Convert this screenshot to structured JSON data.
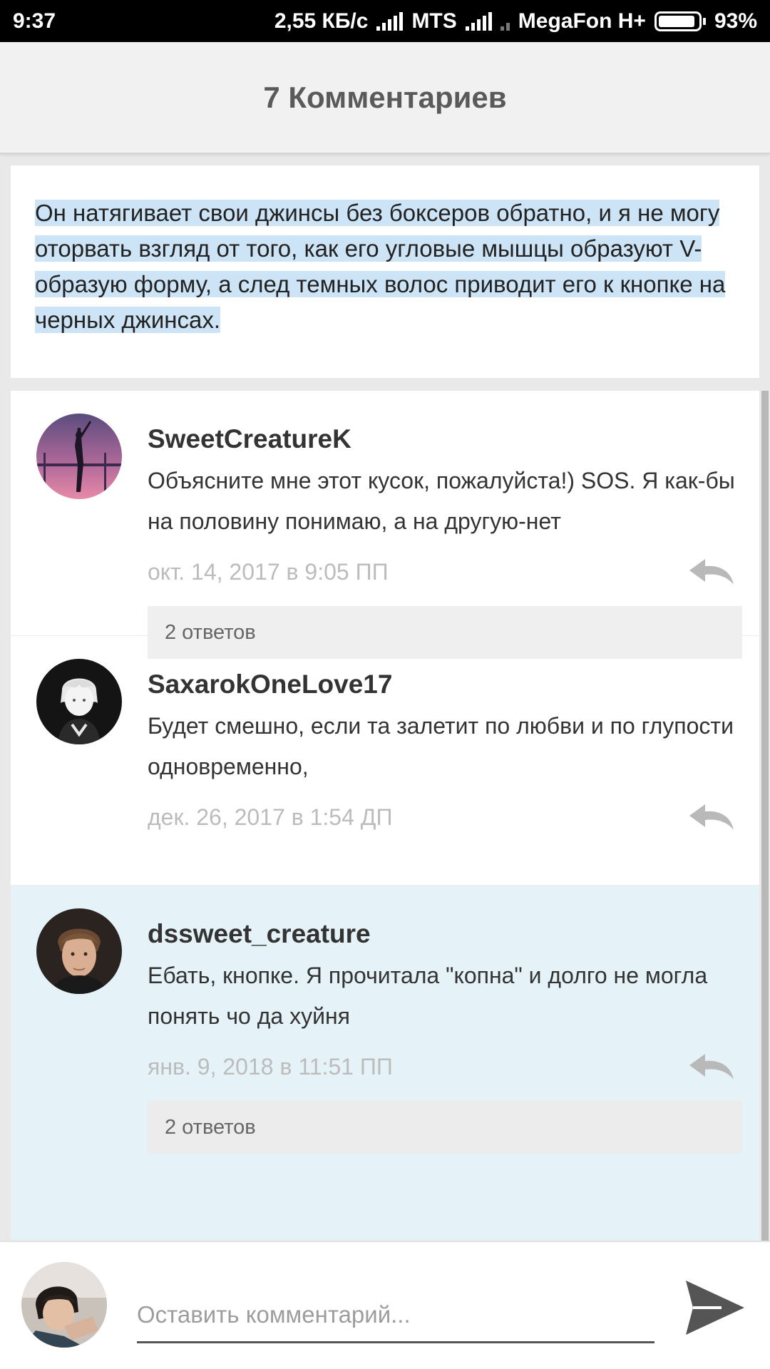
{
  "status_bar": {
    "time": "9:37",
    "speed": "2,55 КБ/с",
    "carrier1": "MTS",
    "carrier2": "MegaFon H+",
    "battery": "93%",
    "battery_level": 0.93
  },
  "header": {
    "title": "7 Комментариев"
  },
  "quote": {
    "text": "Он натягивает свои джинсы без боксеров обратно, и я не могу оторвать взгляд от того, как его угловые мышцы образуют V-образую форму, а след темных волос приводит его к кнопке на черных джинсах."
  },
  "comments": [
    {
      "username": "SweetCreatureK",
      "text": "Объясните мне этот кусок, пожалуйста!) SOS. Я как-бы на половину понимаю, а на другую-нет",
      "date": "окт. 14, 2017 в 9:05 ПП",
      "replies": "2 ответов"
    },
    {
      "username": "SaxarokOneLove17",
      "text": "Будет смешно, если та залетит по любви и по глупости одновременно,",
      "date": "дек. 26, 2017 в 1:54 ДП"
    },
    {
      "username": "dssweet_creature",
      "text": "Ебать, кнопке. Я прочитала \"копна\" и долго не могла понять чо да хуйня",
      "date": "янв. 9, 2018 в 11:51 ПП",
      "replies": "2 ответов"
    }
  ],
  "composer": {
    "placeholder": "Оставить комментарий..."
  },
  "colors": {
    "highlight_bg": "#e5f2f8",
    "selection": "#cde4f6",
    "muted_text": "#bcbcbc"
  },
  "icons": [
    "signal-icon",
    "battery-icon",
    "reply-icon",
    "send-icon"
  ]
}
